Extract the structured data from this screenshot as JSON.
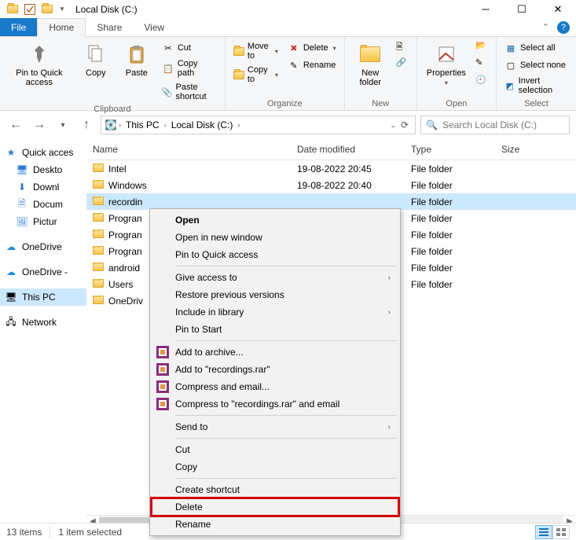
{
  "window": {
    "title": "Local Disk (C:)",
    "qa_dropdown_glyph": "▾"
  },
  "tabs": {
    "file": "File",
    "home": "Home",
    "share": "Share",
    "view": "View"
  },
  "ribbon": {
    "clipboard": {
      "label": "Clipboard",
      "pin": "Pin to Quick access",
      "copy": "Copy",
      "paste": "Paste",
      "cut": "Cut",
      "copy_path": "Copy path",
      "paste_shortcut": "Paste shortcut"
    },
    "organize": {
      "label": "Organize",
      "move_to": "Move to",
      "copy_to": "Copy to",
      "delete": "Delete",
      "rename": "Rename"
    },
    "new": {
      "label": "New",
      "new_folder": "New folder"
    },
    "open": {
      "label": "Open",
      "properties": "Properties"
    },
    "select": {
      "label": "Select",
      "select_all": "Select all",
      "select_none": "Select none",
      "invert": "Invert selection"
    }
  },
  "nav": {
    "this_pc": "This PC",
    "location": "Local Disk (C:)",
    "refresh_glyph": "⟳",
    "search_placeholder": "Search Local Disk (C:)"
  },
  "tree": {
    "quick_access": "Quick acces",
    "desktop": "Deskto",
    "downloads": "Downl",
    "documents": "Docum",
    "pictures": "Pictur",
    "onedrive": "OneDrive",
    "onedrive_personal": "OneDrive -",
    "this_pc": "This PC",
    "network": "Network"
  },
  "columns": {
    "name": "Name",
    "date": "Date modified",
    "type": "Type",
    "size": "Size"
  },
  "rows": [
    {
      "name": "Intel",
      "date": "19-08-2022 20:45",
      "type": "File folder"
    },
    {
      "name": "Windows",
      "date": "19-08-2022 20:40",
      "type": "File folder"
    },
    {
      "name": "recordin",
      "date": "",
      "type": "File folder",
      "selected": true
    },
    {
      "name": "Progran",
      "date": "",
      "type": "File folder"
    },
    {
      "name": "Progran",
      "date": "",
      "type": "File folder"
    },
    {
      "name": "Progran",
      "date": "",
      "type": "File folder"
    },
    {
      "name": "android",
      "date": "",
      "type": "File folder"
    },
    {
      "name": "Users",
      "date": "",
      "type": "File folder"
    },
    {
      "name": "OneDriv",
      "date": "",
      "type": ""
    }
  ],
  "context_menu": {
    "open": "Open",
    "open_new_window": "Open in new window",
    "pin_quick": "Pin to Quick access",
    "give_access": "Give access to",
    "restore_prev": "Restore previous versions",
    "include_library": "Include in library",
    "pin_start": "Pin to Start",
    "add_archive": "Add to archive...",
    "add_rar": "Add to \"recordings.rar\"",
    "compress_email": "Compress and email...",
    "compress_rar_email": "Compress to \"recordings.rar\" and email",
    "send_to": "Send to",
    "cut": "Cut",
    "copy": "Copy",
    "create_shortcut": "Create shortcut",
    "delete": "Delete",
    "rename": "Rename"
  },
  "status": {
    "items": "13 items",
    "selected": "1 item selected"
  }
}
